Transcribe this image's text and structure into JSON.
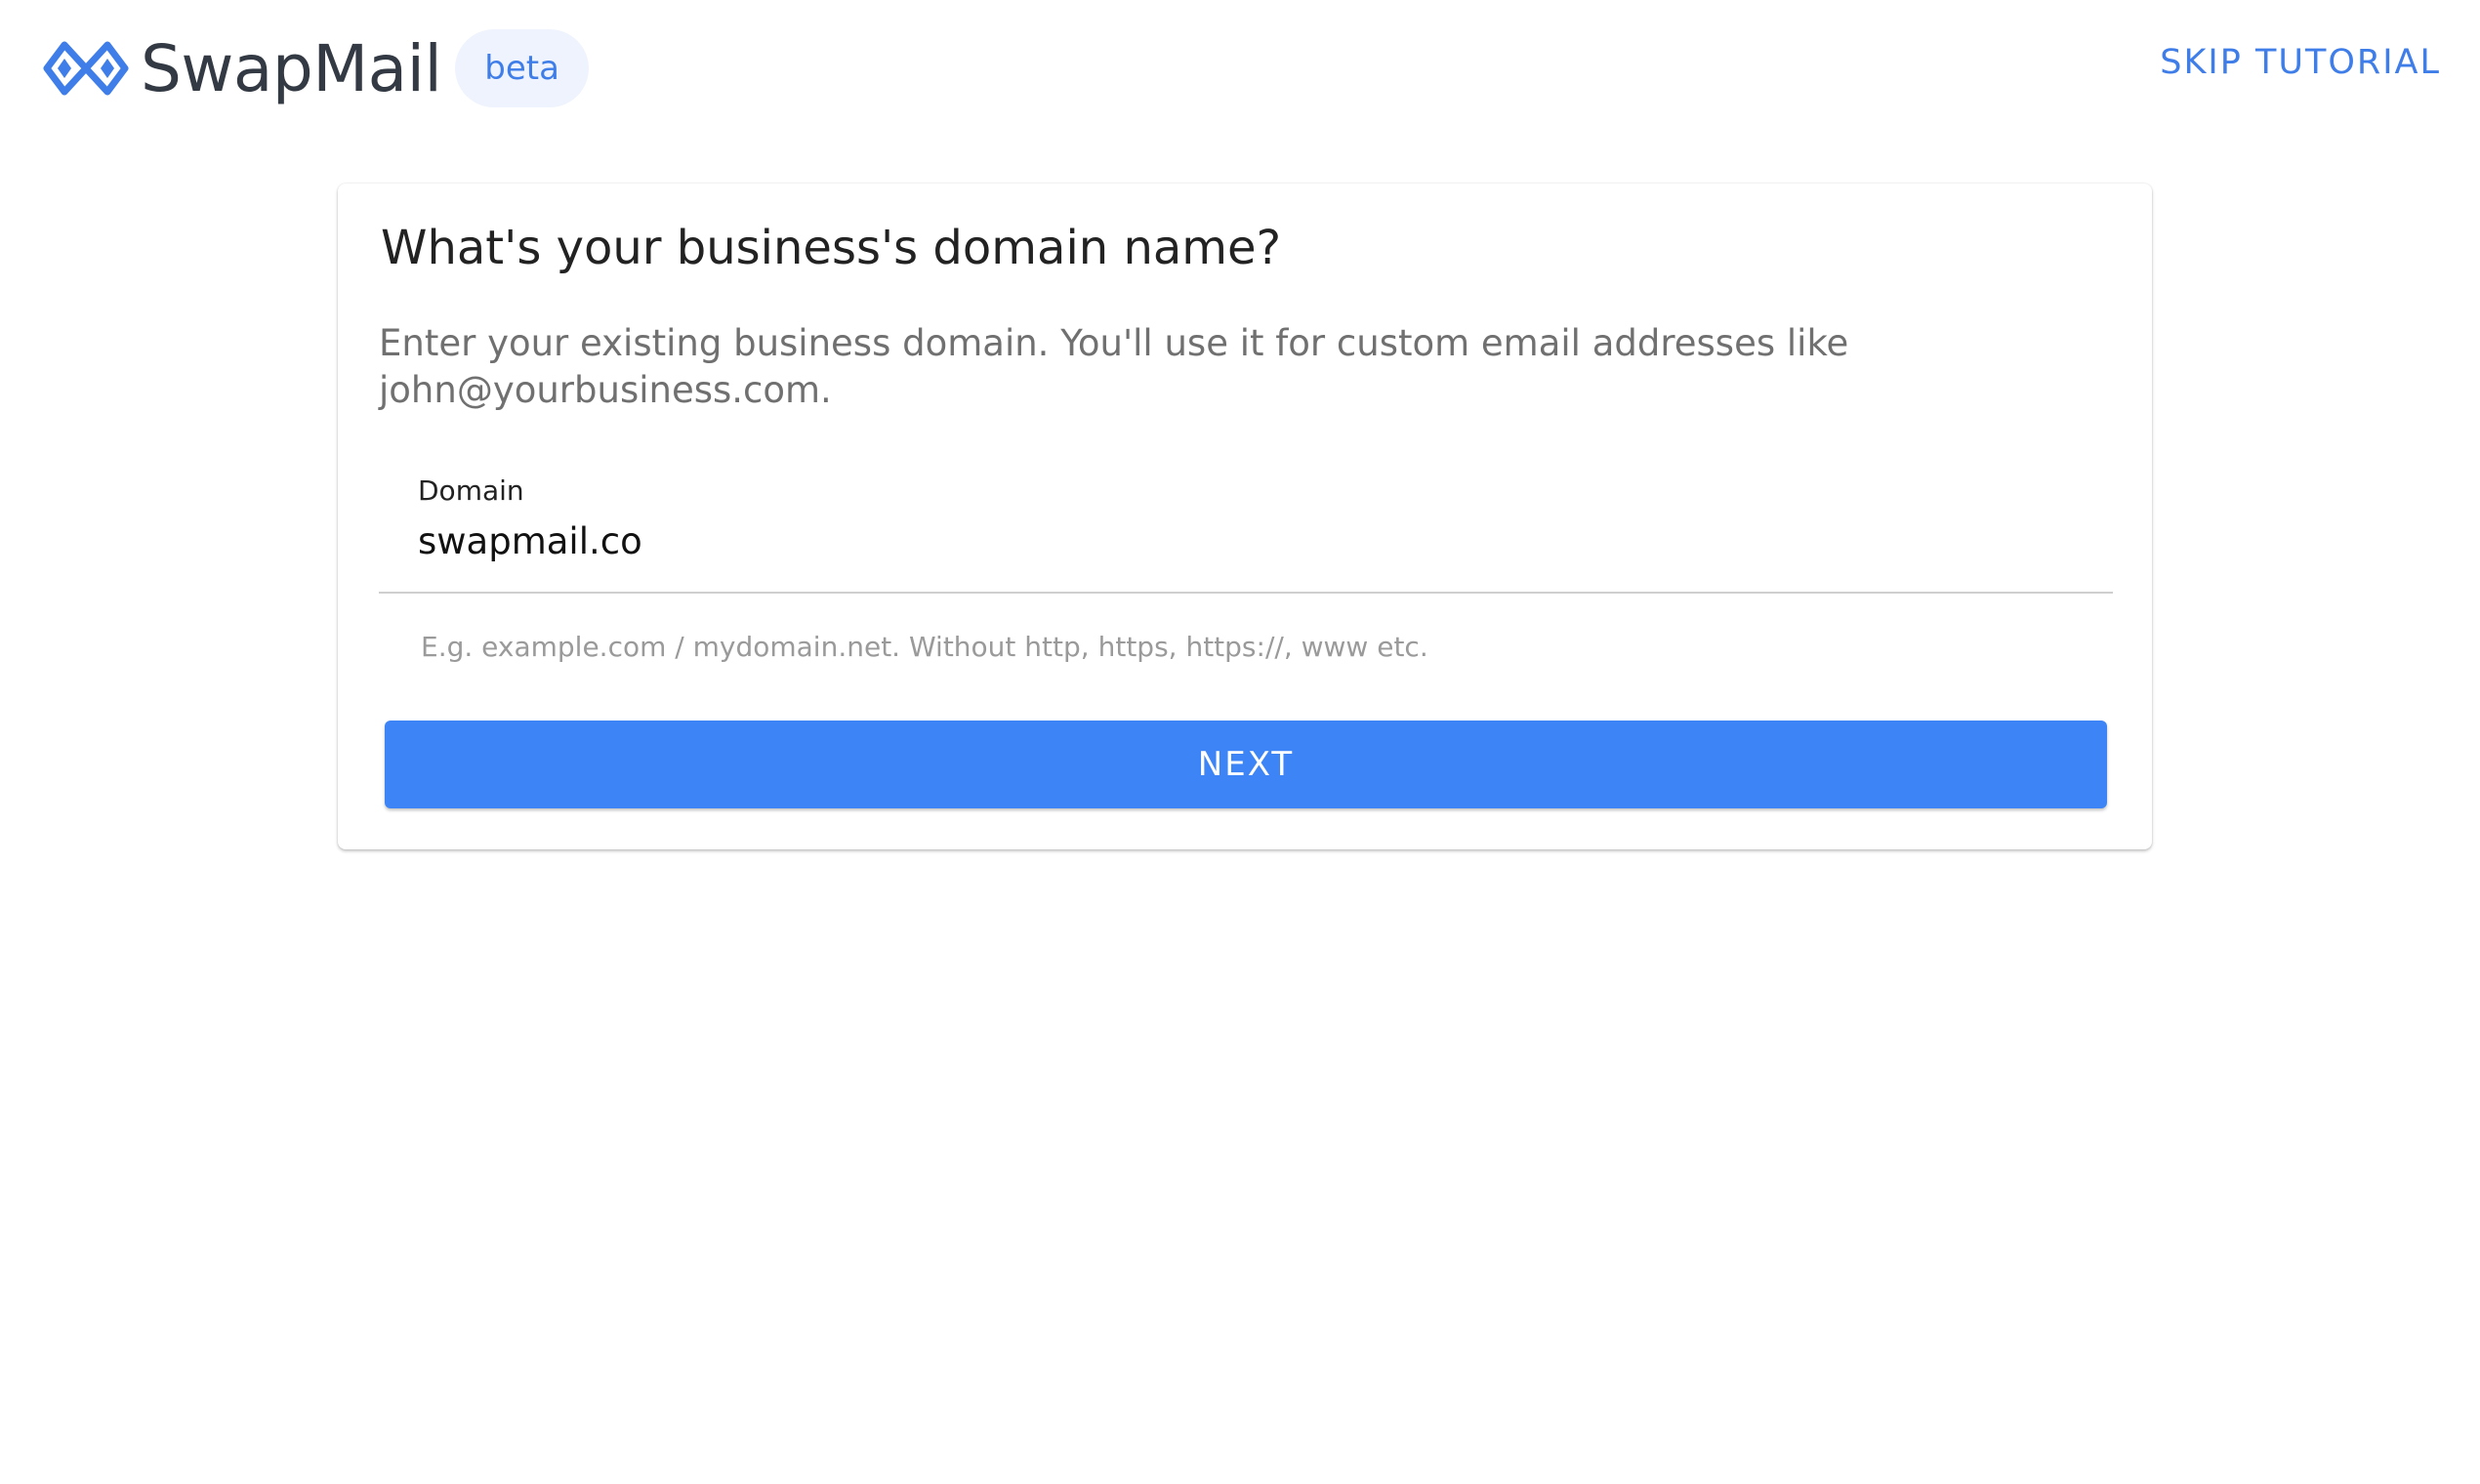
{
  "header": {
    "logo_icon": "swapmail-logo-icon",
    "brand": "SwapMail",
    "badge": "beta",
    "skip_label": "SKIP TUTORIAL"
  },
  "card": {
    "title": "What's your business's domain name?",
    "description": "Enter your existing business domain. You'll use it for custom email addresses like john@yourbusiness.com.",
    "domain_field": {
      "label": "Domain",
      "value": "swapmail.co",
      "helper": "E.g. example.com / mydomain.net. Without http, https, https://, www etc."
    },
    "next_label": "NEXT"
  },
  "colors": {
    "accent": "#3d85f7",
    "link": "#3f7ee8",
    "badge_bg": "#eef3fd"
  }
}
